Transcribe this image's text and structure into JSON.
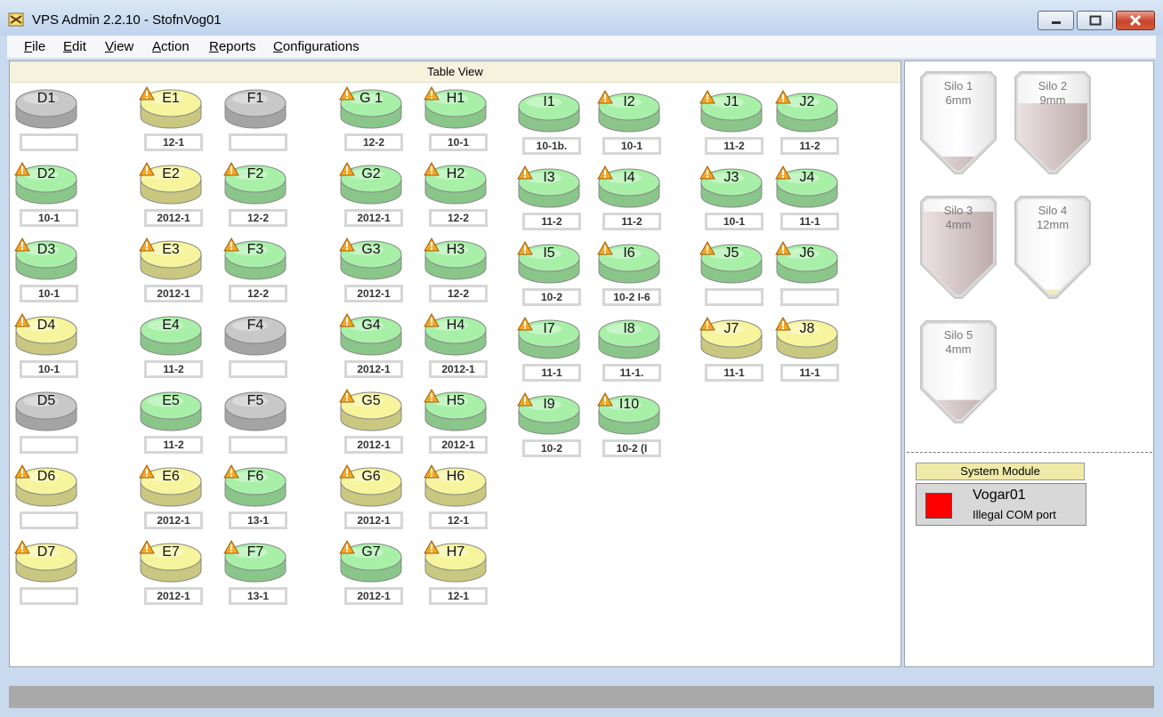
{
  "window": {
    "title": "VPS Admin 2.2.10 - StofnVog01"
  },
  "menu": [
    {
      "label": "File",
      "ul": "F",
      "rest": "ile"
    },
    {
      "label": "Edit",
      "ul": "E",
      "rest": "dit"
    },
    {
      "label": "View",
      "ul": "V",
      "rest": "iew"
    },
    {
      "label": "Action",
      "ul": "A",
      "rest": "ction"
    },
    {
      "label": "Reports",
      "ul": "R",
      "rest": "eports"
    },
    {
      "label": "Configurations",
      "ul": "C",
      "rest": "onfigurations"
    }
  ],
  "table_view": {
    "header": "Table View",
    "colors": {
      "gray": "#c8c8c8",
      "green": "#a8f0a8",
      "yellow": "#f6f49c"
    },
    "tables": [
      {
        "name": "D1",
        "label": "",
        "color": "gray",
        "warn": false
      },
      {
        "name": "D2",
        "label": "10-1",
        "color": "green",
        "warn": true
      },
      {
        "name": "D3",
        "label": "10-1",
        "color": "green",
        "warn": true
      },
      {
        "name": "D4",
        "label": "10-1",
        "color": "yellow",
        "warn": true
      },
      {
        "name": "D5",
        "label": "",
        "color": "gray",
        "warn": false
      },
      {
        "name": "D6",
        "label": "",
        "color": "yellow",
        "warn": true
      },
      {
        "name": "D7",
        "label": "",
        "color": "yellow",
        "warn": true
      },
      {
        "name": "E1",
        "label": "12-1",
        "color": "yellow",
        "warn": true
      },
      {
        "name": "E2",
        "label": "2012-1",
        "color": "yellow",
        "warn": true
      },
      {
        "name": "E3",
        "label": "2012-1",
        "color": "yellow",
        "warn": true
      },
      {
        "name": "E4",
        "label": "11-2",
        "color": "green",
        "warn": false
      },
      {
        "name": "E5",
        "label": "11-2",
        "color": "green",
        "warn": false
      },
      {
        "name": "E6",
        "label": "2012-1",
        "color": "yellow",
        "warn": true
      },
      {
        "name": "E7",
        "label": "2012-1",
        "color": "yellow",
        "warn": true
      },
      {
        "name": "F1",
        "label": "",
        "color": "gray",
        "warn": false
      },
      {
        "name": "F2",
        "label": "12-2",
        "color": "green",
        "warn": true
      },
      {
        "name": "F3",
        "label": "12-2",
        "color": "green",
        "warn": true
      },
      {
        "name": "F4",
        "label": "",
        "color": "gray",
        "warn": false
      },
      {
        "name": "F5",
        "label": "",
        "color": "gray",
        "warn": false
      },
      {
        "name": "F6",
        "label": "13-1",
        "color": "green",
        "warn": true
      },
      {
        "name": "F7",
        "label": "13-1",
        "color": "green",
        "warn": true
      },
      {
        "name": "G 1",
        "label": "12-2",
        "color": "green",
        "warn": true
      },
      {
        "name": "G2",
        "label": "2012-1",
        "color": "green",
        "warn": true
      },
      {
        "name": "G3",
        "label": "2012-1",
        "color": "green",
        "warn": true
      },
      {
        "name": "G4",
        "label": "2012-1",
        "color": "green",
        "warn": true
      },
      {
        "name": "G5",
        "label": "2012-1",
        "color": "yellow",
        "warn": true
      },
      {
        "name": "G6",
        "label": "2012-1",
        "color": "yellow",
        "warn": true
      },
      {
        "name": "G7",
        "label": "2012-1",
        "color": "green",
        "warn": true
      },
      {
        "name": "H1",
        "label": "10-1",
        "color": "green",
        "warn": true
      },
      {
        "name": "H2",
        "label": "12-2",
        "color": "green",
        "warn": true
      },
      {
        "name": "H3",
        "label": "12-2",
        "color": "green",
        "warn": true
      },
      {
        "name": "H4",
        "label": "2012-1",
        "color": "green",
        "warn": true
      },
      {
        "name": "H5",
        "label": "2012-1",
        "color": "green",
        "warn": true
      },
      {
        "name": "H6",
        "label": "12-1",
        "color": "yellow",
        "warn": true
      },
      {
        "name": "H7",
        "label": "12-1",
        "color": "yellow",
        "warn": true
      },
      {
        "name": "I1",
        "label": "10-1b.",
        "color": "green",
        "warn": false
      },
      {
        "name": "I3",
        "label": "11-2",
        "color": "green",
        "warn": true
      },
      {
        "name": "I5",
        "label": "10-2",
        "color": "green",
        "warn": true
      },
      {
        "name": "I7",
        "label": "11-1",
        "color": "green",
        "warn": true
      },
      {
        "name": "I9",
        "label": "10-2",
        "color": "green",
        "warn": true
      },
      {
        "name": "I2",
        "label": "10-1",
        "color": "green",
        "warn": true
      },
      {
        "name": "I4",
        "label": "11-2",
        "color": "green",
        "warn": true
      },
      {
        "name": "I6",
        "label": "10-2 I-6",
        "color": "green",
        "warn": true
      },
      {
        "name": "I8",
        "label": "11-1.",
        "color": "green",
        "warn": false
      },
      {
        "name": "I10",
        "label": "10-2 (I",
        "color": "green",
        "warn": true
      },
      {
        "name": "J1",
        "label": "11-2",
        "color": "green",
        "warn": true
      },
      {
        "name": "J3",
        "label": "10-1",
        "color": "green",
        "warn": true
      },
      {
        "name": "J5",
        "label": "",
        "color": "green",
        "warn": true
      },
      {
        "name": "J7",
        "label": "11-1",
        "color": "yellow",
        "warn": true
      },
      {
        "name": "J2",
        "label": "11-2",
        "color": "green",
        "warn": true
      },
      {
        "name": "J4",
        "label": "11-1",
        "color": "green",
        "warn": true
      },
      {
        "name": "J6",
        "label": "",
        "color": "green",
        "warn": true
      },
      {
        "name": "J8",
        "label": "11-1",
        "color": "yellow",
        "warn": true
      }
    ]
  },
  "silos": [
    {
      "name": "Silo 1",
      "size": "6mm",
      "fill_fraction": 0.14,
      "color": "#b8a6a6"
    },
    {
      "name": "Silo 2",
      "size": "9mm",
      "fill_fraction": 0.7,
      "color": "#b8a6a6"
    },
    {
      "name": "Silo 3",
      "size": "4mm",
      "fill_fraction": 0.87,
      "color": "#b8a6a6"
    },
    {
      "name": "Silo 4",
      "size": "12mm",
      "fill_fraction": 0.05,
      "color": "#f4f296"
    },
    {
      "name": "Silo 5",
      "size": "4mm",
      "fill_fraction": 0.2,
      "color": "#b8a6a6"
    }
  ],
  "system_module": {
    "header": "System Module",
    "name": "Vogar01",
    "message": "Illegal COM port",
    "status_color": "#ff0000"
  }
}
